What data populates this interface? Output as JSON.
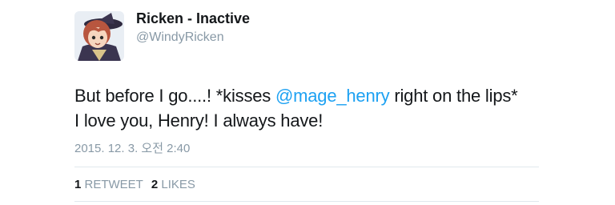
{
  "user": {
    "display_name": "Ricken - Inactive",
    "handle": "@WindyRicken"
  },
  "tweet": {
    "line1_before": "But before I go....! *kisses ",
    "mention": "@mage_henry",
    "line1_after": " right on the lips*",
    "line2": "I love you, Henry! I always have!",
    "timestamp": "2015. 12. 3. 오전 2:40"
  },
  "stats": {
    "retweet_count": "1",
    "retweet_label": "RETWEET",
    "likes_count": "2",
    "likes_label": "LIKES"
  },
  "colors": {
    "mention": "#1da1f2",
    "meta_text": "#8899a6",
    "primary_text": "#14171a",
    "divider": "#e1e8ed"
  }
}
